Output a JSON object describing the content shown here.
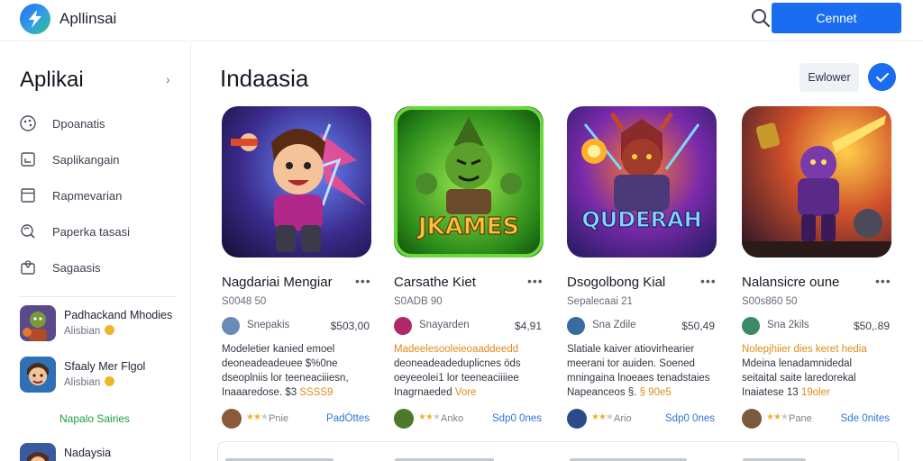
{
  "header": {
    "brand": "Apllinsai",
    "connect_label": "Cennet"
  },
  "sidebar": {
    "title": "Aplikai",
    "nav": [
      {
        "label": "Dpoanatis",
        "icon": "palette-icon"
      },
      {
        "label": "Saplikangain",
        "icon": "download-box-icon"
      },
      {
        "label": "Rapmevarian",
        "icon": "calendar-icon"
      },
      {
        "label": "Paperka tasasi",
        "icon": "refresh-search-icon"
      },
      {
        "label": "Sagaasis",
        "icon": "shopping-bag-icon"
      }
    ],
    "apps": [
      {
        "name": "Padhackand Mhodies",
        "sub": "Alisbian"
      },
      {
        "name": "Sfaaly Mer Flgol",
        "sub": "Alisbian"
      }
    ],
    "green_link": "Napalo Sairies",
    "last_app": {
      "name": "Nadaysia"
    }
  },
  "main": {
    "title": "Indaasia",
    "filter_label": "Ewlower",
    "cards": [
      {
        "name": "Nagdariai Mengiar",
        "sub": "S0048 50",
        "dev": "Snepakis",
        "price": "$503,00",
        "desc_lines": [
          "Modeletier kanied emoel",
          "deoneadeadeuee $%0ne",
          "dseoplniis lor teeneaciiiesn,",
          "Inaaaredose. $3"
        ],
        "desc_hl": "SSSS9",
        "rating": "Pnie",
        "link": "PadÓttes"
      },
      {
        "name": "Carsathe Kiet",
        "sub": "S0ADB 90",
        "dev": "Snayarden",
        "price": "$4,91",
        "desc_lines": [
          "Madeelesooleieoaaddeedd",
          "deoneadeadeduplicnes öds",
          "oeyeeolei1 lor teeneaciiiiee",
          "Inagrnaeded"
        ],
        "desc_hl": "Vore",
        "rating": "Anko",
        "link": "Sdp0 0nes",
        "image_text": "JKAMES"
      },
      {
        "name": "Dsogolbong Kial",
        "sub": "Sepalecaai 21",
        "dev": "Sna Zdile",
        "price": "$50,49",
        "desc_lines": [
          "Slatiale kaiver atiovirhearier",
          "meerani tor auiden. Soened",
          "mningaina lnoeaes tenadstaies",
          "Napeanceos §."
        ],
        "desc_hl": "§ 90e5",
        "rating": "Ario",
        "link": "Sdp0 0nes",
        "image_text": "QUDERAH"
      },
      {
        "name": "Nalansicre oune",
        "sub": "S00s860 50",
        "dev": "Sna 2kils",
        "price": "$50,.89",
        "desc_lines": [
          "Nolepjhiier dies keret hedia",
          "Mdeina lenadamnidedal",
          "seitaital saite laredorekal",
          "Inaiatese 13"
        ],
        "desc_hl": "19oler",
        "rating": "Pane",
        "link": "Sde 0nites"
      }
    ]
  },
  "colors": {
    "accent": "#1a6cf0",
    "green": "#1f9d3d",
    "star": "#f0b429"
  }
}
